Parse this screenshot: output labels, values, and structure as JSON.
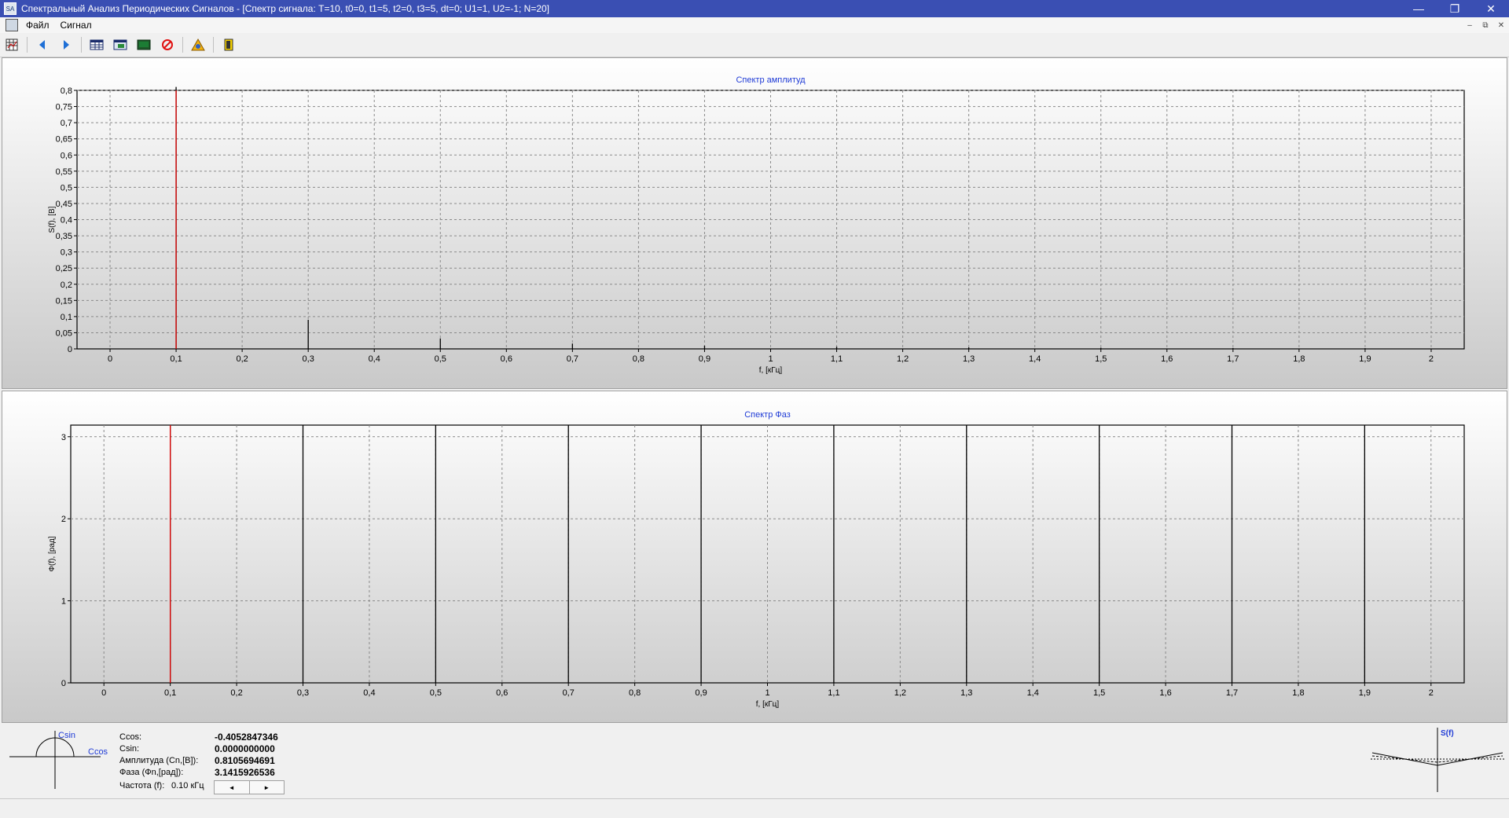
{
  "window": {
    "title": "Спектральный Анализ Периодических Сигналов - [Спектр сигнала: T=10, t0=0, t1=5, t2=0, t3=5, dt=0; U1=1, U2=-1; N=20]",
    "icon_label": "SA",
    "minimize_symbol": "—",
    "restore_symbol": "❐",
    "close_symbol": "✕"
  },
  "menu": {
    "items": [
      "Файл",
      "Сигнал"
    ]
  },
  "mdi_controls": [
    "–",
    "⧉",
    "✕"
  ],
  "toolbar": {
    "icons": [
      "grid-icon",
      "arrow-left-icon",
      "arrow-right-icon",
      "table-icon",
      "table-image-icon",
      "screen-icon",
      "stop-icon",
      "warning-icon",
      "exit-door-icon"
    ]
  },
  "colors": {
    "cursor": "#e00000",
    "title": "#1f3bd6",
    "bars": "#000000"
  },
  "chart_data": [
    {
      "type": "bar",
      "title": "Спектр амплитуд",
      "xlabel": "f, [кГц]",
      "ylabel": "S(f), [B]",
      "xlim": [
        -0.05,
        2.05
      ],
      "ylim": [
        0,
        0.8
      ],
      "x_ticks": [
        "0",
        "0,1",
        "0,2",
        "0,3",
        "0,4",
        "0,5",
        "0,6",
        "0,7",
        "0,8",
        "0,9",
        "1",
        "1,1",
        "1,2",
        "1,3",
        "1,4",
        "1,5",
        "1,6",
        "1,7",
        "1,8",
        "1,9",
        "2"
      ],
      "y_ticks": [
        "0",
        "0,05",
        "0,1",
        "0,15",
        "0,2",
        "0,25",
        "0,3",
        "0,35",
        "0,4",
        "0,45",
        "0,5",
        "0,55",
        "0,6",
        "0,65",
        "0,7",
        "0,75",
        "0,8"
      ],
      "grid": true,
      "cursor_x": 0.1,
      "x": [
        0.1,
        0.3,
        0.5,
        0.7,
        0.9,
        1.1,
        1.3,
        1.5,
        1.7,
        1.9
      ],
      "values": [
        0.8106,
        0.0901,
        0.0324,
        0.0165,
        0.01,
        0.0067,
        0.0048,
        0.0036,
        0.0028,
        0.0022
      ]
    },
    {
      "type": "bar",
      "title": "Спектр Фаз",
      "xlabel": "f, [кГц]",
      "ylabel": "Ф(f), [рад]",
      "xlim": [
        -0.05,
        2.05
      ],
      "ylim": [
        0,
        3.1416
      ],
      "x_ticks": [
        "0",
        "0,1",
        "0,2",
        "0,3",
        "0,4",
        "0,5",
        "0,6",
        "0,7",
        "0,8",
        "0,9",
        "1",
        "1,1",
        "1,2",
        "1,3",
        "1,4",
        "1,5",
        "1,6",
        "1,7",
        "1,8",
        "1,9",
        "2"
      ],
      "y_ticks": [
        "0",
        "1",
        "2",
        "3"
      ],
      "grid": true,
      "cursor_x": 0.1,
      "x": [
        0.1,
        0.3,
        0.5,
        0.7,
        0.9,
        1.1,
        1.3,
        1.5,
        1.7,
        1.9
      ],
      "values": [
        3.1416,
        3.1416,
        3.1416,
        3.1416,
        3.1416,
        3.1416,
        3.1416,
        3.1416,
        3.1416,
        3.1416
      ]
    }
  ],
  "info": {
    "diagram": {
      "csin": "Csin",
      "ccos": "Ccos"
    },
    "rows": [
      {
        "label": "Ccos:",
        "value": "-0.4052847346"
      },
      {
        "label": "Csin:",
        "value": "0.0000000000"
      },
      {
        "label": "Амплитуда (Cn,[B]):",
        "value": "0.8105694691"
      },
      {
        "label": "Фаза (Фn,[рад]):",
        "value": "3.1415926536"
      }
    ],
    "freq_label": "Частота (f):",
    "freq_value": "0.10 кГц",
    "scroll_left": "◄",
    "scroll_right": "►",
    "mini_chart_label": "S(f)"
  }
}
